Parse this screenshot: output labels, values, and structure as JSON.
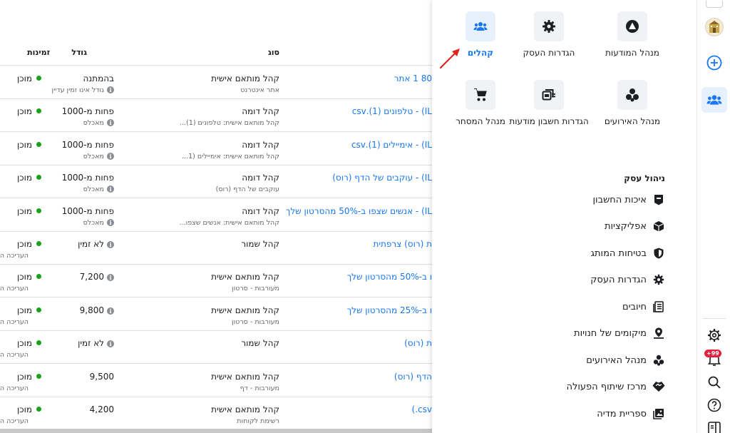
{
  "table": {
    "headers": {
      "type": "סוג",
      "size": "גודל",
      "availability": "זמינות"
    },
    "rows": [
      {
        "name": "80 1 אתר",
        "type": "קהל מותאם אישית",
        "type_sub": "אתר אינטרנט",
        "size": "בהמתנה",
        "size_sub": "גודל אינו זמין עדיין",
        "availability": "מוכן",
        "availability_sub": ""
      },
      {
        "name": "IL) - טלפונים (1).csv",
        "type": "קהל דומה",
        "type_sub": "קהל מותאם אישית: טלפונים (1)...",
        "size": "פחות מ-1000",
        "size_sub": "מאכלס",
        "availability": "מוכן",
        "availability_sub": ""
      },
      {
        "name": "IL) - אימיילים (1).csv",
        "type": "קהל דומה",
        "type_sub": "קהל מותאם אישית: אימיילים (1...",
        "size": "פחות מ-1000",
        "size_sub": "מאכלס",
        "availability": "מוכן",
        "availability_sub": ""
      },
      {
        "name": "IL) - עוקבים של הדף (רוס)",
        "type": "קהל דומה",
        "type_sub": "עוקבים של הדף (רוס)",
        "size": "פחות מ-1000",
        "size_sub": "מאכלס",
        "availability": "מוכן",
        "availability_sub": ""
      },
      {
        "name": "IL) - אנשים שצפו ב-50% מהסרטון שלך",
        "type": "קהל דומה",
        "type_sub": "קהל מותאם אישית: אנשים שצפו...",
        "size": "פחות מ-1000",
        "size_sub": "מאכלס",
        "availability": "מוכן",
        "availability_sub": ""
      },
      {
        "name": "ת (רוס) צרפתית",
        "type": "קהל שמור",
        "type_sub": "",
        "size": "לא זמין",
        "size_sub": "",
        "availability": "מוכן",
        "availability_sub": "העריכה האחר"
      },
      {
        "name": "ו ב-50% מהסרטון שלך",
        "type": "קהל מותאם אישית",
        "type_sub": "מעורבות - סרטון",
        "size": "7,200",
        "size_sub": "",
        "availability": "מוכן",
        "availability_sub": "העריכה האחר"
      },
      {
        "name": "ו ב-25% מהסרטון שלך",
        "type": "קהל מותאם אישית",
        "type_sub": "מעורבות - סרטון",
        "size": "9,800",
        "size_sub": "",
        "availability": "מוכן",
        "availability_sub": "העריכה האחר"
      },
      {
        "name": "ת (רוס)",
        "type": "קהל שמור",
        "type_sub": "",
        "size": "לא זמין",
        "size_sub": "",
        "availability": "מוכן",
        "availability_sub": "העריכה האחר"
      },
      {
        "name": "הדף (רוס)",
        "type": "קהל מותאם אישית",
        "type_sub": "מעורבות - דף",
        "size": "9,500",
        "size_sub": "",
        "availability": "מוכן",
        "availability_sub": "העריכה האחר"
      },
      {
        "name": "csv.)",
        "type": "קהל מותאם אישית",
        "type_sub": "רשימת לקוחות",
        "size": "4,200",
        "size_sub": "",
        "availability": "מוכן",
        "availability_sub": "העריכה האחר"
      }
    ]
  },
  "menu": {
    "tiles": [
      {
        "label": "מנהל המודעות",
        "icon": "ads-manager-icon"
      },
      {
        "label": "הגדרות העסק",
        "icon": "gear-icon"
      },
      {
        "label": "קהלים",
        "icon": "audiences-icon",
        "active": true
      },
      {
        "label": "מנהל האירועים",
        "icon": "events-manager-icon"
      },
      {
        "label": "הגדרות חשבון מודעות",
        "icon": "ad-account-settings-icon"
      },
      {
        "label": "מנהל המסחר",
        "icon": "cart-icon"
      }
    ],
    "section_title": "ניהול עסק",
    "items": [
      {
        "label": "איכות החשבון",
        "icon": "account-quality-icon"
      },
      {
        "label": "אפליקציות",
        "icon": "apps-icon"
      },
      {
        "label": "בטיחות המותג",
        "icon": "shield-icon"
      },
      {
        "label": "הגדרות העסק",
        "icon": "gear-icon"
      },
      {
        "label": "חיובים",
        "icon": "billing-icon"
      },
      {
        "label": "מיקומים של חנויות",
        "icon": "store-location-icon"
      },
      {
        "label": "מנהל האירועים",
        "icon": "events-manager-icon"
      },
      {
        "label": "מרכז שיתוף הפעולה",
        "icon": "handshake-icon"
      },
      {
        "label": "ספריית מדיה",
        "icon": "media-library-icon"
      }
    ]
  },
  "rail": {
    "badge": "+99",
    "icons": [
      "avatar",
      "plus-circle-icon",
      "audiences-icon",
      "gear-icon",
      "bell-icon",
      "search-icon",
      "help-icon",
      "sidebar-toggle-icon"
    ]
  },
  "colors": {
    "accent": "#1877f2",
    "ready_dot": "#1aa31a",
    "annotation_arrow": "#e0231b"
  }
}
